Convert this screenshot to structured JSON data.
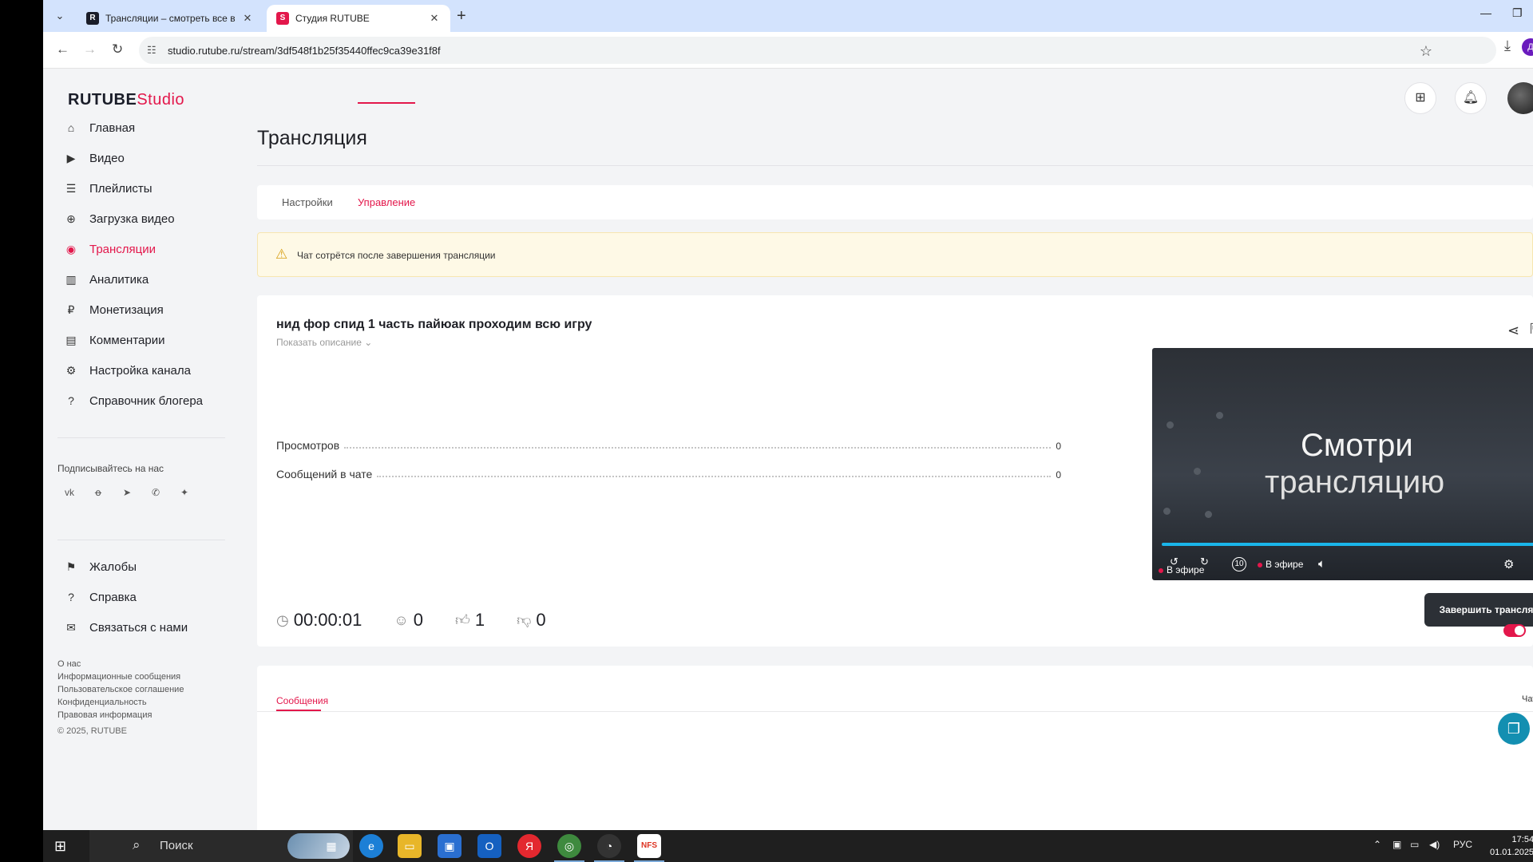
{
  "browser": {
    "tabs": [
      {
        "label": "Трансляции – смотреть все в",
        "favicon": "R",
        "favicon_color": "#1a1d29"
      },
      {
        "label": "Студия RUTUBE",
        "favicon": "S",
        "favicon_color": "#e3174b"
      }
    ],
    "url": "studio.rutube.ru/stream/3df548f1b25f35440ffec9ca39e31f8f",
    "profile_letter": "Д"
  },
  "logo": {
    "main": "RUTUBE",
    "sub": "Studio"
  },
  "nav": [
    {
      "label": "Главная",
      "icon": "home-icon",
      "glyph": "⌂"
    },
    {
      "label": "Видео",
      "icon": "video-icon",
      "glyph": "▶"
    },
    {
      "label": "Плейлисты",
      "icon": "list-icon",
      "glyph": "☰"
    },
    {
      "label": "Загрузка видео",
      "icon": "upload-icon",
      "glyph": "⊕"
    },
    {
      "label": "Трансляции",
      "icon": "broadcast-icon",
      "glyph": "◉"
    },
    {
      "label": "Аналитика",
      "icon": "analytics-icon",
      "glyph": "▥"
    },
    {
      "label": "Монетизация",
      "icon": "ruble-icon",
      "glyph": "₽"
    },
    {
      "label": "Комментарии",
      "icon": "comment-icon",
      "glyph": "▤"
    },
    {
      "label": "Настройка канала",
      "icon": "gear-icon",
      "glyph": "⚙"
    },
    {
      "label": "Справочник блогера",
      "icon": "help-bubble-icon",
      "glyph": "?"
    }
  ],
  "follow_label": "Подписывайтесь на нас",
  "socials": [
    {
      "name": "vk-icon",
      "glyph": "vk"
    },
    {
      "name": "ok-icon",
      "glyph": "ꝋ"
    },
    {
      "name": "telegram-icon",
      "glyph": "➤"
    },
    {
      "name": "viber-icon",
      "glyph": "✆"
    },
    {
      "name": "plus-icon",
      "glyph": "✦"
    }
  ],
  "nav2": [
    {
      "label": "Жалобы",
      "icon": "flag-icon",
      "glyph": "⚑"
    },
    {
      "label": "Справка",
      "icon": "question-icon",
      "glyph": "?"
    },
    {
      "label": "Связаться с нами",
      "icon": "mail-icon",
      "glyph": "✉"
    }
  ],
  "footer_links": [
    "О нас",
    "Информационные сообщения",
    "Пользовательское соглашение",
    "Конфиденциальность",
    "Правовая информация"
  ],
  "copyright": "© 2025, RUTUBE",
  "page_title": "Трансляция",
  "page_tabs": {
    "settings": "Настройки",
    "manage": "Управление"
  },
  "warning": "Чат сотрётся после завершения трансляции",
  "stream": {
    "title": "нид фор спид 1 часть пайюак проходим всю игру",
    "show_description": "Показать описание",
    "views_label": "Просмотров",
    "views_value": "0",
    "chat_label": "Сообщений в чате",
    "chat_value": "0",
    "duration": "00:00:01",
    "viewers": "0",
    "likes": "1",
    "dislikes": "0"
  },
  "player": {
    "line1": "Смотри",
    "line2": "трансляцию",
    "live_label": "В эфире",
    "rewind_label": "10",
    "progress": 1.0
  },
  "end_button": "Завершить трансляцию",
  "messages": {
    "tab": "Сообщения",
    "chat_toggle": "Чат",
    "chat_enabled": true
  },
  "taskbar": {
    "search": "Поиск",
    "lang": "РУС",
    "time": "17:54",
    "date": "01.01.2025"
  },
  "colors": {
    "accent": "#e3174b",
    "dark_button": "#2c3036",
    "progress": "#1ab5ea"
  }
}
